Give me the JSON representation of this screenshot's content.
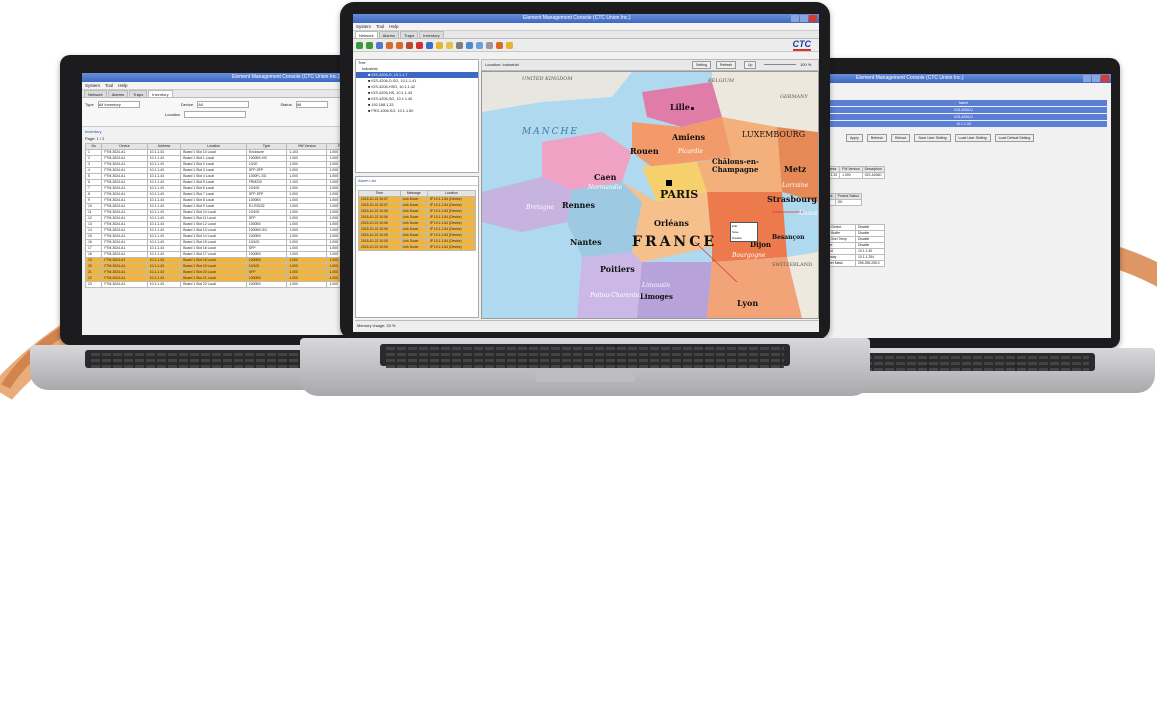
{
  "app": {
    "title_center": "Element Management Console (CTC Union Inc.)",
    "title_left": "Element Management Console (CTC Union Inc.)",
    "title_right": "Element Management Console (CTC Union Inc.)"
  },
  "menu": {
    "system": "System",
    "tool": "Tool",
    "help": "Help"
  },
  "tabs": [
    "Network",
    "Alarms",
    "Traps",
    "Inventory"
  ],
  "logo": "CTC",
  "center": {
    "tree_items": [
      "Tree",
      "Industrial",
      "■ IGS-4206-D, 10.1.1.7",
      "■ IGS-4206-D-SG, 10.1.1.41",
      "■ IGS-4206-HSG, 10.1.1.42",
      "■ IGS-4206-HS, 10.1.1.43",
      "■ IGS-4206-SG, 10.1.1.40",
      "■ 192.168.1.33",
      "■ FRS-1006-SG, 10.1.1.50"
    ],
    "location_label": "Location: Industrial",
    "map_buttons": [
      "Setting",
      "Refresh",
      "Up"
    ],
    "zoom": "100 %",
    "alarm_panel_title": "Alarm List",
    "alarm_headers": [
      "Time",
      "Message",
      "Location"
    ],
    "alarm_rows": [
      [
        "2015-10-22 10:07",
        "Link Down",
        "IP 10.1.1.54 (Device)"
      ],
      [
        "2015-10-22 10:07",
        "Link Down",
        "IP 10.1.1.54 (Device)"
      ],
      [
        "2015-10-22 10:06",
        "Link Down",
        "IP 10.1.1.54 (Device)"
      ],
      [
        "2015-10-22 10:06",
        "Link Down",
        "IP 10.1.1.54 (Device)"
      ],
      [
        "2015-10-22 10:06",
        "Link Down",
        "IP 10.1.1.54 (Device)"
      ],
      [
        "2015-10-22 10:05",
        "Link Down",
        "IP 10.1.1.54 (Device)"
      ],
      [
        "2015-10-22 10:05",
        "Link Down",
        "IP 10.1.1.54 (Device)"
      ],
      [
        "2015-10-22 10:05",
        "Link Down",
        "IP 10.1.1.54 (Device)"
      ],
      [
        "2015-10-22 10:04",
        "Link Down",
        "IP 10.1.1.54 (Device)"
      ]
    ],
    "status": "Memory Usage: 33 %",
    "map_labels": {
      "uk": "UNITED KINGDOM",
      "belgium": "BELGIUM",
      "germany": "GERMANY",
      "luxembourg": "LUXEMBOURG",
      "manche": "MANCHE",
      "lille": "Lille",
      "amiens": "Amiens",
      "rouen": "Rouen",
      "caen": "Caen",
      "paris": "PARIS",
      "chalons": "Châlons-en-Champagne",
      "metz": "Metz",
      "strasbourg": "Strasbourg",
      "rennes": "Rennes",
      "orleans": "Orléans",
      "nantes": "Nantes",
      "france": "FRANCE",
      "poitiers": "Poitiers",
      "limoges": "Limoges",
      "lyon": "Lyon",
      "switzerland": "SWITZERLAND",
      "bretagne": "Bretagne",
      "normandie": "Normandie",
      "picardie": "Picardie",
      "lorraine": "Lorraine",
      "alsace": "Alsace",
      "bourgogne": "Bourgogne",
      "poitou": "Poitou-Charentes",
      "limousin": "Limousin",
      "dijon": "Dijon",
      "besancon": "Besançon",
      "popup_items": [
        "Edit",
        "Save",
        "Disable"
      ]
    }
  },
  "left": {
    "filters": {
      "type_label": "Type",
      "device_label": "Device",
      "status_label": "Status",
      "location_label": "Location",
      "type_value": "All Inventory",
      "device_value": "All",
      "status_value": "All"
    },
    "section_title": "Inventory",
    "page": "Page: 1 / 2",
    "headers": [
      "No",
      "Device",
      "Address",
      "Location",
      "Type",
      "HW Version",
      "FW Version"
    ],
    "rows": [
      [
        "1",
        "FTM-3024-A1",
        "10.1.1.43",
        "Board 1 Slot 10 Local",
        "Enclosure",
        "1.103",
        "1.000"
      ],
      [
        "2",
        "FTM-3024-A1",
        "10.1.1.43",
        "Board 1 Slot 1 Local",
        "1000BX-HS",
        "1.000",
        "1.000"
      ],
      [
        "3",
        "FTM-3024-A1",
        "10.1.1.43",
        "Board 1 Slot 2 Local",
        "10/20",
        "1.000",
        "1.000"
      ],
      [
        "4",
        "FTM-3024-A1",
        "10.1.1.43",
        "Board 1 Slot 3 Local",
        "SFP-SFP",
        "1.000",
        "1.000"
      ],
      [
        "5",
        "FTM-3024-A1",
        "10.1.1.43",
        "Board 1 Slot 4 Local",
        "1000FL-SG",
        "1.000",
        "1.000"
      ],
      [
        "6",
        "FTM-3024-A1",
        "10.1.1.43",
        "Board 1 Slot 5 Local",
        "FRM220",
        "1.103",
        "1.000"
      ],
      [
        "7",
        "FTM-3024-A1",
        "10.1.1.43",
        "Board 1 Slot 6 Local",
        "10/100",
        "1.000",
        "1.000"
      ],
      [
        "8",
        "FTM-3024-A1",
        "10.1.1.43",
        "Board 1 Slot 7 Local",
        "SFP-SFP",
        "1.000",
        "1.000"
      ],
      [
        "9",
        "FTM-3024-A1",
        "10.1.1.43",
        "Board 1 Slot 8 Local",
        "1000BX",
        "1.000",
        "1.000"
      ],
      [
        "10",
        "FTM-3024-A1",
        "10.1.1.43",
        "Board 1 Slot 9 Local",
        "E1-RS232",
        "1.000",
        "1.000"
      ],
      [
        "11",
        "FTM-3024-A1",
        "10.1.1.43",
        "Board 1 Slot 10 Local",
        "10/100",
        "1.000",
        "1.000"
      ],
      [
        "12",
        "FTM-3024-A1",
        "10.1.1.43",
        "Board 1 Slot 11 Local",
        "SFP",
        "1.000",
        "1.000"
      ],
      [
        "13",
        "FTM-3024-A1",
        "10.1.1.43",
        "Board 1 Slot 12 Local",
        "1000BX",
        "1.000",
        "1.000"
      ],
      [
        "14",
        "FTM-3024-A1",
        "10.1.1.43",
        "Board 1 Slot 13 Local",
        "1000BX-SG",
        "1.000",
        "1.000"
      ],
      [
        "15",
        "FTM-3024-A1",
        "10.1.1.43",
        "Board 1 Slot 14 Local",
        "1000BX",
        "1.000",
        "1.000"
      ],
      [
        "16",
        "FTM-3024-A1",
        "10.1.1.43",
        "Board 1 Slot 15 Local",
        "10/100",
        "1.000",
        "1.000"
      ],
      [
        "17",
        "FTM-3024-A1",
        "10.1.1.43",
        "Board 1 Slot 16 Local",
        "SFP",
        "1.000",
        "1.000"
      ],
      [
        "18",
        "FTM-3024-A1",
        "10.1.1.43",
        "Board 1 Slot 17 Local",
        "1000BX",
        "1.000",
        "1.000"
      ],
      [
        "19",
        "FTM-3024-A1",
        "10.1.1.43",
        "Board 1 Slot 18 Local",
        "1000BX",
        "1.000",
        "1.000"
      ],
      [
        "20",
        "FTM-3024-A1",
        "10.1.1.43",
        "Board 1 Slot 19 Local",
        "10/100",
        "1.000",
        "1.000"
      ],
      [
        "21",
        "FTM-3024-A1",
        "10.1.1.43",
        "Board 1 Slot 20 Local",
        "SFP",
        "1.000",
        "1.000"
      ],
      [
        "22",
        "FTM-3024-A1",
        "10.1.1.43",
        "Board 1 Slot 21 Local",
        "1000BX",
        "1.000",
        "1.000"
      ],
      [
        "23",
        "FTM-3024-A1",
        "10.1.1.43",
        "Board 1 Slot 22 Local",
        "1000BX",
        "1.000",
        "1.000"
      ]
    ]
  },
  "right": {
    "blue_bars": [
      "Name",
      "IGS-4206-D",
      "IGS-4206-D",
      "10.1.1.33"
    ],
    "buttons": [
      "Apply",
      "Refresh",
      "Reboot",
      "Save User Setting",
      "Load User Setting",
      "Load Default Setting"
    ],
    "info_headers": [
      "Address",
      "FW Version",
      "Description"
    ],
    "info_row": [
      "10.1.1.33",
      "1.000",
      "IGS-4206D"
    ],
    "status_headers": [
      "Status",
      "Protect Status"
    ],
    "status_row": [
      "OK",
      "OK"
    ],
    "settings": [
      [
        "Loop Detect",
        "Disable"
      ],
      [
        "Jitter Buffer",
        "Disable"
      ],
      [
        "SFP Over Temp",
        "Disable"
      ],
      [
        "Power",
        "Disable"
      ],
      [
        "Speed",
        "10.1.1.40"
      ],
      [
        "Gateway",
        "10.1.1.254"
      ],
      [
        "Subnet Mask",
        "255.255.255.0"
      ]
    ]
  }
}
